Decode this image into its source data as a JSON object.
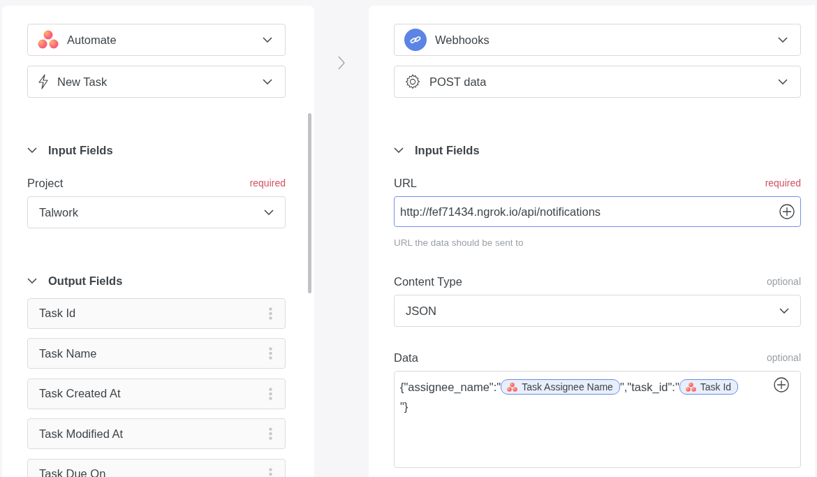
{
  "trigger": {
    "app": {
      "label": "Automate"
    },
    "event": {
      "label": "New Task"
    },
    "input_section": {
      "title": "Input Fields",
      "expanded": true
    },
    "input_fields": [
      {
        "label": "Project",
        "badge": "required",
        "required": true,
        "value": "Talwork",
        "focused": false
      }
    ],
    "output_section": {
      "title": "Output Fields",
      "expanded": true
    },
    "output_fields": [
      "Task Id",
      "Task Name",
      "Task Created At",
      "Task Modified At",
      "Task Due On"
    ]
  },
  "action": {
    "app": {
      "label": "Webhooks"
    },
    "event": {
      "label": "POST data"
    },
    "input_section": {
      "title": "Input Fields",
      "expanded": true
    },
    "url": {
      "label": "URL",
      "badge": "required",
      "required": true,
      "value": "http://fef71434.ngrok.io/api/notifications",
      "focused": true,
      "hint": "URL the data should be sent to"
    },
    "content_type": {
      "label": "Content Type",
      "badge": "optional",
      "required": false,
      "value": "JSON",
      "focused": false
    },
    "data": {
      "label": "Data",
      "badge": "optional",
      "required": false,
      "lines": [
        [
          {
            "kind": "text",
            "text": "{\"assignee_name\":\""
          },
          {
            "kind": "token",
            "text": "Task Assignee Name"
          },
          {
            "kind": "text",
            "text": "\",\"task_id\":\""
          },
          {
            "kind": "token",
            "text": "Task Id"
          }
        ],
        [
          {
            "kind": "text",
            "text": "\"}"
          }
        ]
      ]
    }
  }
}
